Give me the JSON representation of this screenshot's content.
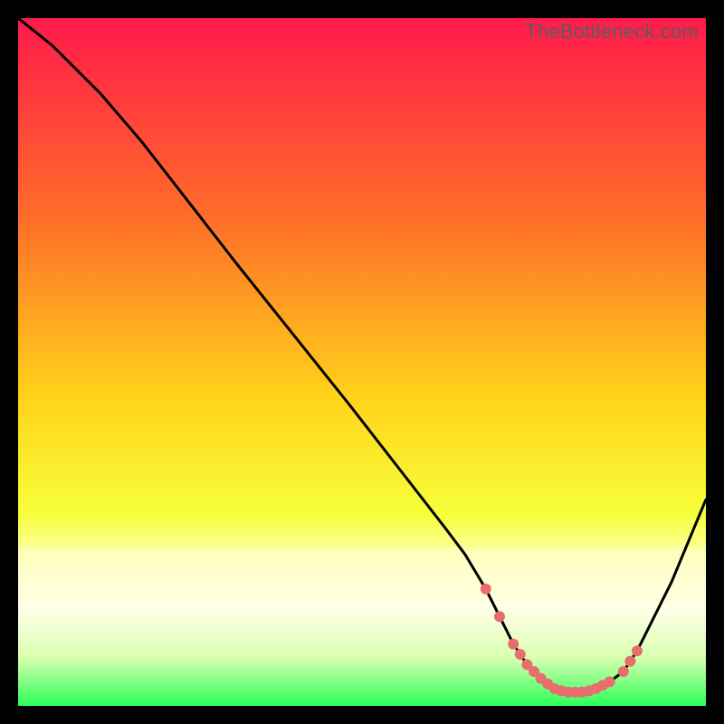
{
  "watermark": "TheBottleneck.com",
  "colors": {
    "bg_black": "#000000",
    "grad_top": "#ff1a4b",
    "grad_mid1": "#ff6a2a",
    "grad_mid2": "#ffd21a",
    "grad_mid3": "#f7ff3a",
    "grad_bottom": "#2aff5a",
    "pale_yellow": "#ffffc8",
    "line": "#000000",
    "dot": "#e86d6d"
  },
  "chart_data": {
    "type": "line",
    "title": "",
    "xlabel": "",
    "ylabel": "",
    "xlim": [
      0,
      100
    ],
    "ylim": [
      0,
      100
    ],
    "x": [
      0,
      5,
      8,
      12,
      18,
      25,
      32,
      40,
      48,
      55,
      62,
      65,
      68,
      70,
      72,
      74,
      76,
      78,
      80,
      82,
      84,
      86,
      88,
      90,
      92,
      95,
      100
    ],
    "y": [
      100,
      96,
      93,
      89,
      82,
      73,
      64,
      54,
      44,
      35,
      26,
      22,
      17,
      13,
      9,
      6,
      4,
      2.5,
      2,
      2,
      2.5,
      3.5,
      5,
      8,
      12,
      18,
      30
    ],
    "dots_x": [
      68,
      70,
      72,
      73,
      74,
      75,
      76,
      77,
      78,
      79,
      80,
      81,
      82,
      83,
      84,
      85,
      86,
      88,
      89,
      90
    ],
    "dots_y": [
      17,
      13,
      9,
      7.5,
      6,
      5,
      4,
      3.2,
      2.5,
      2.2,
      2,
      2,
      2,
      2.2,
      2.5,
      3,
      3.5,
      5,
      6.5,
      8
    ]
  }
}
